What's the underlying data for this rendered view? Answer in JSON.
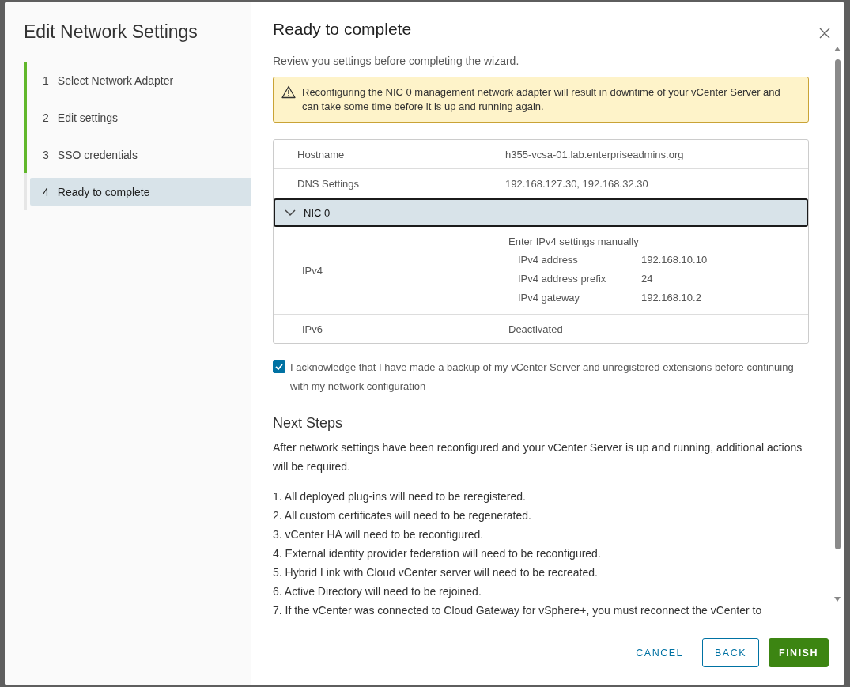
{
  "dialog": {
    "title": "Edit Network Settings"
  },
  "steps": [
    {
      "number": "1",
      "label": "Select Network Adapter",
      "completed": true,
      "selected": false
    },
    {
      "number": "2",
      "label": "Edit settings",
      "completed": true,
      "selected": false
    },
    {
      "number": "3",
      "label": "SSO credentials",
      "completed": true,
      "selected": false
    },
    {
      "number": "4",
      "label": "Ready to complete",
      "completed": false,
      "selected": true
    }
  ],
  "page": {
    "title": "Ready to complete",
    "description": "Review you settings before completing the wizard."
  },
  "warning": "Reconfiguring the NIC 0 management network adapter will result in downtime of your vCenter Server and can take some time before it is up and running again.",
  "summary": {
    "rows": [
      {
        "label": "Hostname",
        "value": "h355-vcsa-01.lab.enterpriseadmins.org"
      },
      {
        "label": "DNS Settings",
        "value": "192.168.127.30, 192.168.32.30"
      }
    ],
    "nic": {
      "label": "NIC 0",
      "expanded": true,
      "ipv4": {
        "label": "IPv4",
        "mode": "Enter IPv4 settings manually",
        "fields": [
          {
            "label": "IPv4 address",
            "value": "192.168.10.10"
          },
          {
            "label": "IPv4 address prefix",
            "value": "24"
          },
          {
            "label": "IPv4 gateway",
            "value": "192.168.10.2"
          }
        ]
      },
      "ipv6": {
        "label": "IPv6",
        "value": "Deactivated"
      }
    }
  },
  "acknowledge": {
    "text": "I acknowledge that I have made a backup of my vCenter Server and unregistered extensions before continuing with my network configuration",
    "checked": true
  },
  "next_steps": {
    "title": "Next Steps",
    "intro": "After network settings have been reconfigured and your vCenter Server is up and running, additional actions will be required.",
    "items": [
      "1. All deployed plug-ins will need to be reregistered.",
      "2. All custom certificates will need to be regenerated.",
      "3. vCenter HA will need to be reconfigured.",
      "4. External identity provider federation will need to be reconfigured.",
      "5. Hybrid Link with Cloud vCenter server will need to be recreated.",
      "6. Active Directory will need to be rejoined.",
      "7. If the vCenter was connected to Cloud Gateway for vSphere+, you must reconnect the vCenter to"
    ]
  },
  "buttons": [
    {
      "label": "CANCEL",
      "kind": "link"
    },
    {
      "label": "BACK",
      "kind": "outline"
    },
    {
      "label": "FINISH",
      "kind": "primary"
    }
  ]
}
